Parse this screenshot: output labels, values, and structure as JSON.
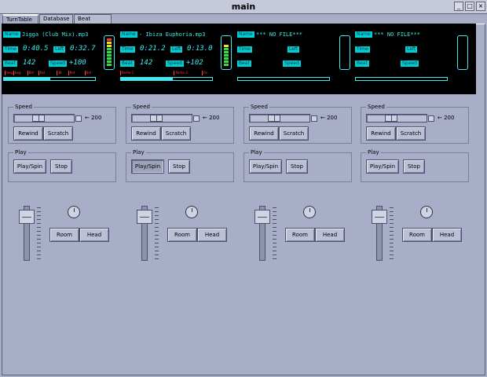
{
  "window": {
    "title": "main"
  },
  "tabs": [
    {
      "label": "TurnTable"
    },
    {
      "label": "Database"
    },
    {
      "label": "Beat Editor"
    }
  ],
  "colors": {
    "lcd_bg": "#000000",
    "lcd_text": "#40e8f0",
    "cue": "#ff3c3c",
    "panel": "#a9aec8"
  },
  "lcd_labels": {
    "name": "Name",
    "time": "Time",
    "left": "Left",
    "beat": "Beat",
    "speed": "Speed"
  },
  "decks": [
    {
      "name": "Jigga (Club Mix).mp3",
      "time": "0:40.5",
      "left": "0:32.7",
      "beat": "142",
      "speed": "+100",
      "progress": 0.51,
      "meter_level": 0.9,
      "cues": [
        {
          "pos": 0.02,
          "label": "beg"
        },
        {
          "pos": 0.11,
          "label": "beg"
        },
        {
          "pos": 0.26,
          "label": "Bst"
        },
        {
          "pos": 0.38,
          "label": "Ret"
        },
        {
          "pos": 0.58,
          "label": "Bt"
        },
        {
          "pos": 0.7,
          "label": "Ret"
        },
        {
          "pos": 0.88,
          "label": "Bst"
        }
      ]
    },
    {
      "name": "- Ibiza Euphoria.mp3",
      "time": "0:21.2",
      "left": "0:13.0",
      "beat": "142",
      "speed": "+102",
      "progress": 0.57,
      "meter_level": 0.7,
      "cues": [
        {
          "pos": 0.0,
          "label": "Partie 1"
        },
        {
          "pos": 0.58,
          "label": "Partie 3"
        },
        {
          "pos": 0.88,
          "label": "Fin"
        }
      ]
    },
    {
      "name": "*** NO FILE***",
      "time": "",
      "left": "",
      "beat": "",
      "speed": "",
      "progress": 0,
      "meter_level": 0,
      "cues": []
    },
    {
      "name": "*** NO FILE***",
      "time": "",
      "left": "",
      "beat": "",
      "speed": "",
      "progress": 0,
      "meter_level": 0,
      "cues": []
    }
  ],
  "controls": {
    "speed_title": "Speed",
    "speed_value": "← 200",
    "speed_slider_level": 0.5,
    "rewind": "Rewind",
    "scratch": "Scratch",
    "play_title": "Play",
    "play_spin": "Play/Spin",
    "stop": "Stop",
    "room": "Room",
    "head": "Head",
    "fader_level": 0.9
  }
}
